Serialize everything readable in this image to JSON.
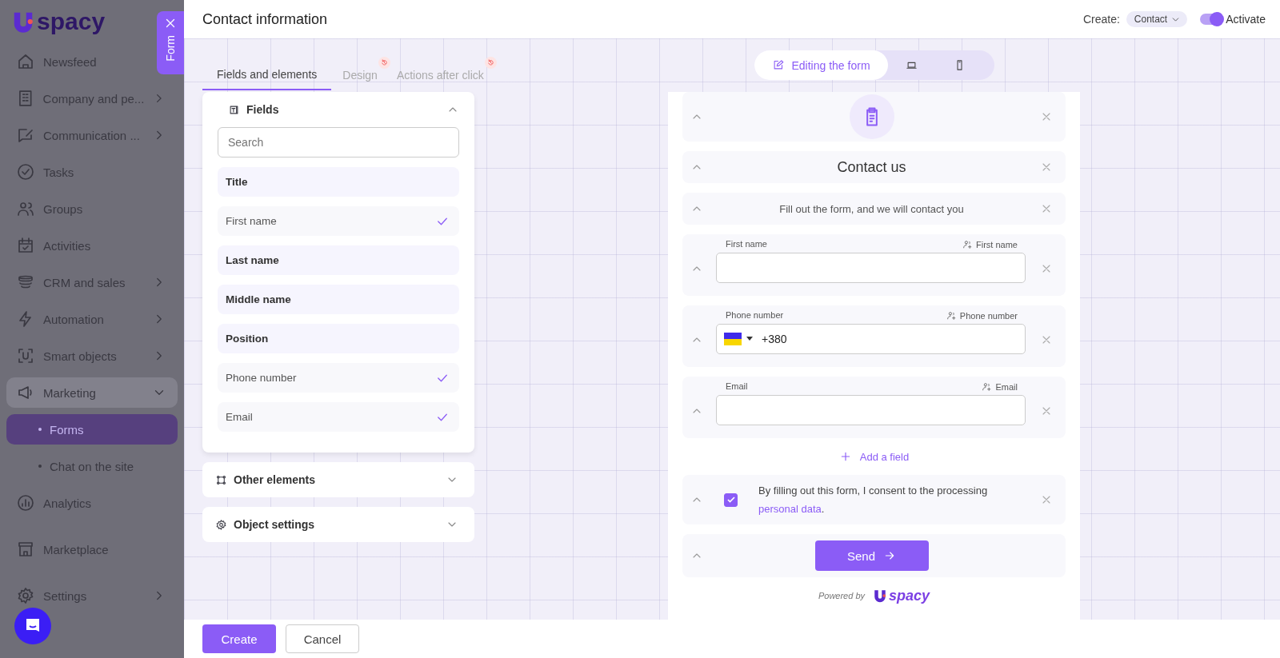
{
  "sidebar": {
    "logo": "spacy",
    "items": [
      {
        "label": "Newsfeed",
        "kind": "item",
        "has_children": false,
        "expanded": false,
        "selected": false
      },
      {
        "label": "Company and pe...",
        "kind": "item",
        "has_children": true,
        "expanded": false,
        "selected": false
      },
      {
        "label": "Communication ...",
        "kind": "item",
        "has_children": true,
        "expanded": false,
        "selected": false
      },
      {
        "label": "Tasks",
        "kind": "item",
        "has_children": false,
        "expanded": false,
        "selected": false
      },
      {
        "label": "Groups",
        "kind": "item",
        "has_children": false,
        "expanded": false,
        "selected": false
      },
      {
        "label": "Activities",
        "kind": "item",
        "has_children": false,
        "expanded": false,
        "selected": false
      },
      {
        "label": "CRM and sales",
        "kind": "item",
        "has_children": true,
        "expanded": false,
        "selected": false
      },
      {
        "label": "Automation",
        "kind": "item",
        "has_children": true,
        "expanded": false,
        "selected": false
      },
      {
        "label": "Smart objects",
        "kind": "item",
        "has_children": true,
        "expanded": false,
        "selected": false
      },
      {
        "label": "Marketing",
        "kind": "item",
        "has_children": true,
        "expanded": true,
        "selected": false
      },
      {
        "label": "Forms",
        "kind": "sub",
        "has_children": false,
        "expanded": false,
        "selected": true
      },
      {
        "label": "Chat on the site",
        "kind": "sub",
        "has_children": false,
        "expanded": false,
        "selected": false
      },
      {
        "label": "Analytics",
        "kind": "item",
        "has_children": false,
        "expanded": false,
        "selected": false
      },
      {
        "label": "Marketplace",
        "kind": "item",
        "has_children": false,
        "expanded": false,
        "selected": false
      },
      {
        "label": "Settings",
        "kind": "item",
        "has_children": true,
        "expanded": false,
        "selected": false
      }
    ]
  },
  "form_tab": {
    "label": "Form"
  },
  "header": {
    "title": "Contact information",
    "create_label": "Create:",
    "create_value": "Contact",
    "toggle": {
      "label": "Activate",
      "on": true
    }
  },
  "tabs": [
    {
      "label": "Fields and elements",
      "selected": true,
      "reset_badge": false
    },
    {
      "label": "Design",
      "selected": false,
      "reset_badge": true
    },
    {
      "label": "Actions after click",
      "selected": false,
      "reset_badge": true
    }
  ],
  "fields_panel": {
    "title": "Fields",
    "expanded": true,
    "search": {
      "placeholder": "Search"
    },
    "fields": [
      {
        "label": "Title",
        "checked": false
      },
      {
        "label": "First name",
        "checked": true
      },
      {
        "label": "Last name",
        "checked": false
      },
      {
        "label": "Middle name",
        "checked": false
      },
      {
        "label": "Position",
        "checked": false
      },
      {
        "label": "Phone number",
        "checked": true
      },
      {
        "label": "Email",
        "checked": true
      }
    ]
  },
  "sections": [
    {
      "title": "Other elements",
      "expanded": false
    },
    {
      "title": "Object settings",
      "expanded": false
    }
  ],
  "view_modes": [
    {
      "kind": "edit",
      "label": "Editing the form",
      "selected": true
    },
    {
      "kind": "desktop",
      "selected": false
    },
    {
      "kind": "mobile",
      "selected": false
    }
  ],
  "preview": {
    "blocks": [
      {
        "kind": "image"
      },
      {
        "kind": "heading",
        "text": "Contact us"
      },
      {
        "kind": "subheading",
        "text": "Fill out the form, and we will contact you"
      },
      {
        "kind": "field",
        "label": "First name",
        "mapping": "First name"
      },
      {
        "kind": "phone",
        "label": "Phone number",
        "mapping": "Phone number",
        "value": "+380"
      },
      {
        "kind": "field",
        "label": "Email",
        "mapping": "Email"
      },
      {
        "kind": "add",
        "label": "Add a field"
      },
      {
        "kind": "consent",
        "text": "By filling out this form, I consent to the processing",
        "link": "personal data",
        "suffix": ".",
        "checked": true
      },
      {
        "kind": "button",
        "label": "Send"
      }
    ],
    "powered_by": "Powered by",
    "logo": "spacy"
  },
  "footer": {
    "buttons": [
      {
        "label": "Create",
        "kind": "primary"
      },
      {
        "label": "Cancel",
        "kind": "secondary"
      }
    ]
  }
}
